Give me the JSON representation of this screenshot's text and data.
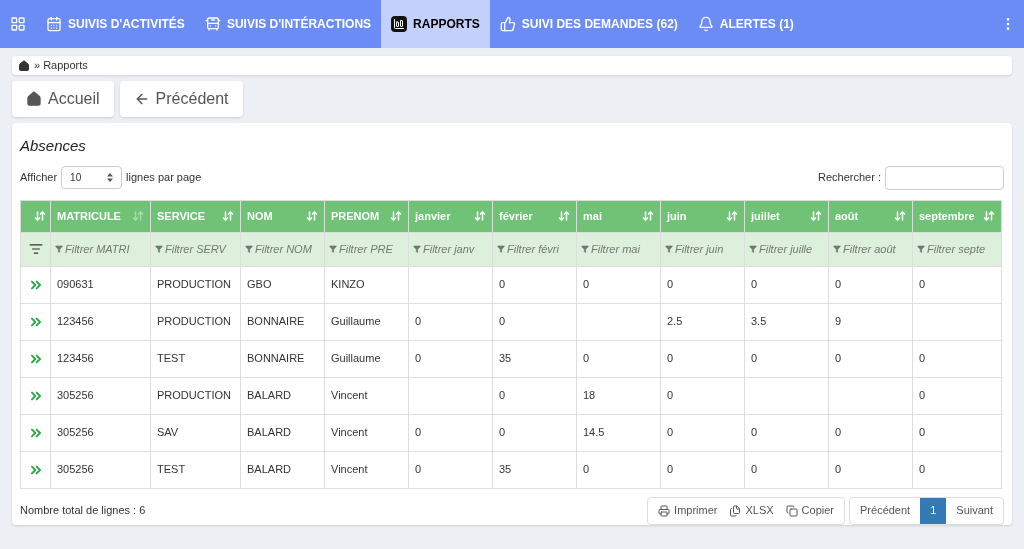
{
  "nav": {
    "items": [
      {
        "label": "SUIVIS D'ACTIVITÉS",
        "kind": "calendar",
        "selected": false
      },
      {
        "label": "SUIVIS D'INTÉRACTIONS",
        "kind": "bus",
        "selected": false
      },
      {
        "label": "RAPPORTS",
        "kind": "chart",
        "selected": true
      },
      {
        "label": "SUIVI DES DEMANDES (62)",
        "kind": "thumbs",
        "selected": false
      },
      {
        "label": "ALERTES (1)",
        "kind": "bell",
        "selected": false
      }
    ]
  },
  "breadcrumb": {
    "current": "» Rapports"
  },
  "buttons": [
    {
      "label": "Accueil",
      "kind": "home"
    },
    {
      "label": "Précédent",
      "kind": "back"
    }
  ],
  "card": {
    "title": "Absences",
    "page_size_prefix": "Afficher",
    "page_size": "10",
    "page_size_suffix": "lignes par page",
    "search_label": "Rechercher :",
    "table": {
      "columns": [
        {
          "label": "MATRICULE",
          "filter": "Filtrer MATRI",
          "sorted": true
        },
        {
          "label": "SERVICE",
          "filter": "Filtrer SERV",
          "sorted": false
        },
        {
          "label": "NOM",
          "filter": "Filtrer NOM",
          "sorted": false
        },
        {
          "label": "PRENOM",
          "filter": "Filtrer PRE",
          "sorted": false
        },
        {
          "label": "janvier",
          "filter": "Filtrer janv",
          "sorted": false
        },
        {
          "label": "février",
          "filter": "Filtrer févri",
          "sorted": false
        },
        {
          "label": "mai",
          "filter": "Filtrer mai",
          "sorted": false
        },
        {
          "label": "juin",
          "filter": "Filtrer juin",
          "sorted": false
        },
        {
          "label": "juillet",
          "filter": "Filtrer juille",
          "sorted": false
        },
        {
          "label": "août",
          "filter": "Filtrer août",
          "sorted": false
        },
        {
          "label": "septembre",
          "filter": "Filtrer septe",
          "sorted": false
        }
      ],
      "rows": [
        [
          "090631",
          "PRODUCTION",
          "GBO",
          "KINZO",
          null,
          "0",
          "0",
          "0",
          "0",
          "0",
          "0"
        ],
        [
          "123456",
          "PRODUCTION",
          "BONNAIRE",
          "Guillaume",
          "0",
          "0",
          null,
          "2.5",
          "3.5",
          "9",
          null
        ],
        [
          "123456",
          "TEST",
          "BONNAIRE",
          "Guillaume",
          "0",
          "35",
          "0",
          "0",
          "0",
          "0",
          "0"
        ],
        [
          "305256",
          "PRODUCTION",
          "BALARD",
          "Vincent",
          null,
          "0",
          "18",
          "0",
          null,
          null,
          "0"
        ],
        [
          "305256",
          "SAV",
          "BALARD",
          "Vincent",
          "0",
          "0",
          "14.5",
          "0",
          "0",
          "0",
          "0"
        ],
        [
          "305256",
          "TEST",
          "BALARD",
          "Vincent",
          "0",
          "35",
          "0",
          "0",
          "0",
          "0",
          "0"
        ]
      ]
    },
    "total": "Nombre total de lignes : 6",
    "export_buttons": [
      {
        "label": "Imprimer",
        "kind": "print"
      },
      {
        "label": "XLSX",
        "kind": "xlsx"
      },
      {
        "label": "Copier",
        "kind": "copy"
      }
    ],
    "pagination": [
      {
        "label": "Précédent",
        "selected": false
      },
      {
        "label": "1",
        "selected": true
      },
      {
        "label": "Suivant",
        "selected": false
      }
    ]
  }
}
